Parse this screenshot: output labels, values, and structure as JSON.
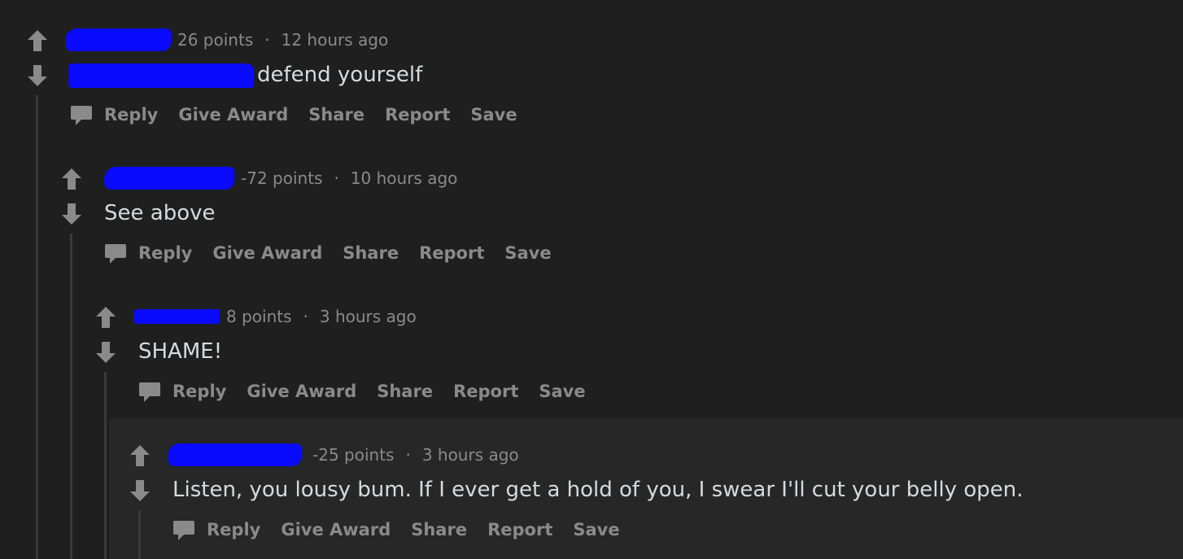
{
  "colors": {
    "background": "#1f1f1f",
    "highlight_background": "#272727",
    "meta_text": "#8a8a8a",
    "body_text": "#d7dadc",
    "redaction": "#0a0aff",
    "thread_line": "#3a3a3a"
  },
  "icons": {
    "upvote": "arrow-up-icon",
    "downvote": "arrow-down-icon",
    "reply": "speech-bubble-icon"
  },
  "actions": {
    "reply": "Reply",
    "give_award": "Give Award",
    "share": "Share",
    "report": "Report",
    "save": "Save"
  },
  "comments": [
    {
      "points": "26 points",
      "time": "12 hours ago",
      "body": "defend yourself"
    },
    {
      "points": "-72 points",
      "time": "10 hours ago",
      "body": "See above"
    },
    {
      "points": "8 points",
      "time": "3 hours ago",
      "body": "SHAME!"
    },
    {
      "points": "-25 points",
      "time": "3 hours ago",
      "body": "Listen, you lousy bum. If I ever get a hold of you, I swear I'll cut your belly open."
    }
  ]
}
